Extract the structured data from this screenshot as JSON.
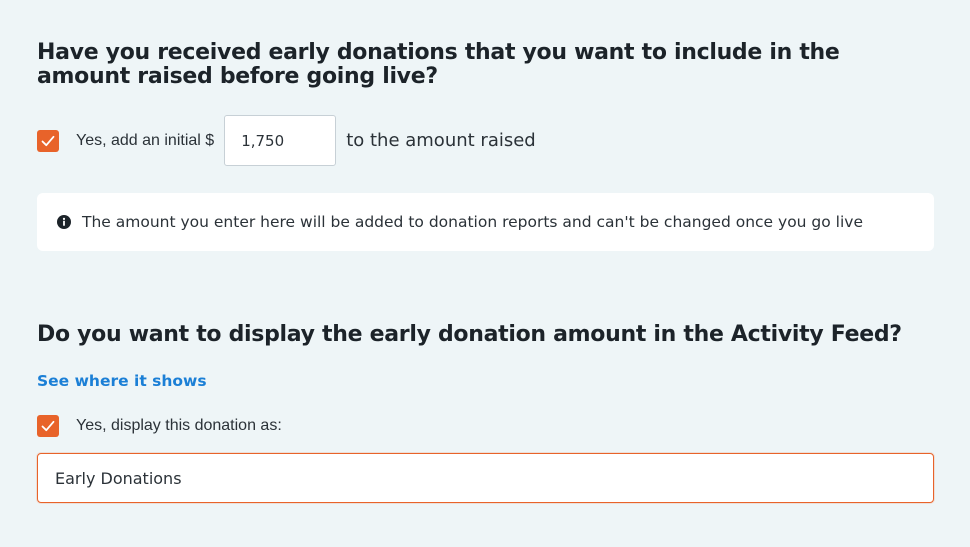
{
  "colors": {
    "background": "#eef5f7",
    "accent": "#e8632a",
    "link": "#1b7fd6",
    "text": "#1c2329"
  },
  "initial_amount_section": {
    "question": "Have you received early donations that you want to include in the amount raised before going live?",
    "checkbox_checked": true,
    "checkbox_label": "Yes, add an initial $",
    "amount_value": "1,750",
    "after_label": "to the amount raised",
    "info_icon": "info-circle-icon",
    "info_text": "The amount you enter here will be added to donation reports and can't be changed once you go live"
  },
  "activity_feed_section": {
    "question": "Do you want to display the early donation amount in the Activity Feed?",
    "link_label": "See where it shows",
    "checkbox_checked": true,
    "checkbox_label": "Yes, display this donation as:",
    "display_value": "Early Donations"
  }
}
